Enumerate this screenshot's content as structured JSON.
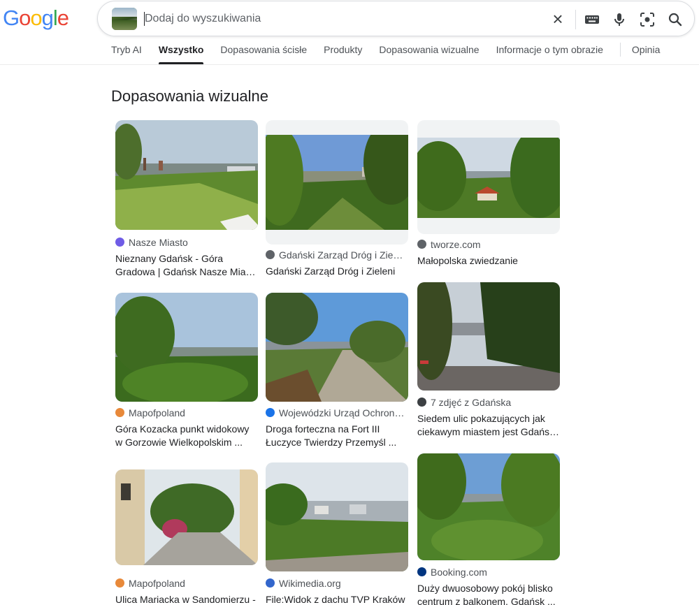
{
  "header": {
    "logo_letters": [
      "G",
      "o",
      "o",
      "g",
      "l",
      "e"
    ],
    "logo_colors": [
      "#4285F4",
      "#EA4335",
      "#FBBC05",
      "#4285F4",
      "#34A853",
      "#EA4335"
    ],
    "search": {
      "placeholder": "Dodaj do wyszukiwania",
      "value": ""
    },
    "icons": [
      "clear-icon",
      "keyboard-icon",
      "microphone-icon",
      "lens-camera-icon",
      "search-icon"
    ]
  },
  "tabs": [
    {
      "label": "Tryb AI",
      "active": false
    },
    {
      "label": "Wszystko",
      "active": true
    },
    {
      "label": "Dopasowania ścisłe",
      "active": false
    },
    {
      "label": "Produkty",
      "active": false
    },
    {
      "label": "Dopasowania wizualne",
      "active": false
    },
    {
      "label": "Informacje o tym obrazie",
      "active": false
    },
    {
      "label": "Opinia",
      "active": false
    }
  ],
  "section": {
    "title": "Dopasowania wizualne"
  },
  "results": [
    {
      "source": "Nasze Miasto",
      "favicon": "nasze-miasto-icon",
      "favicon_color": "#6f5ce6",
      "title_lines": [
        "Nieznany Gdańsk - Góra",
        "Gradowa | Gdańsk Nasze Miasto"
      ]
    },
    {
      "source": "Gdański Zarząd Dróg i Zie…",
      "favicon": "globe-icon",
      "favicon_color": "#5f6368",
      "title_lines": [
        "Gdański Zarząd Dróg i Zieleni"
      ]
    },
    {
      "source": "tworze.com",
      "favicon": "globe-icon",
      "favicon_color": "#5f6368",
      "title_lines": [
        "Małopolska zwiedzanie"
      ]
    },
    {
      "source": "Mapofpoland",
      "favicon": "mapofpoland-icon",
      "favicon_color": "#e8893a",
      "title_lines": [
        "Góra Kozacka punkt widokowy",
        "w Gorzowie Wielkopolskim ..."
      ]
    },
    {
      "source": "Wojewódzki Urząd Ochron…",
      "favicon": "wuoz-icon",
      "favicon_color": "#1a73e8",
      "title_lines": [
        "Droga forteczna na Fort III",
        "Łuczyce Twierdzy Przemyśl ..."
      ]
    },
    {
      "source": "7 zdjęć z Gdańska",
      "favicon": "seven-icon",
      "favicon_color": "#3c4043",
      "title_lines": [
        "Siedem ulic pokazujących jak",
        "ciekawym miastem jest Gdańs…"
      ]
    },
    {
      "source": "Mapofpoland",
      "favicon": "mapofpoland-icon",
      "favicon_color": "#e8893a",
      "title_lines": [
        "Ulica Mariacka w Sandomierzu -"
      ]
    },
    {
      "source": "Wikimedia.org",
      "favicon": "wikimedia-icon",
      "favicon_color": "#3366cc",
      "title_lines": [
        "File:Widok z dachu TVP Kraków"
      ]
    },
    {
      "source": "Booking.com",
      "favicon": "booking-icon",
      "favicon_color": "#003580",
      "title_lines": [
        "Duży dwuosobowy pokój blisko",
        "centrum z balkonem, Gdańsk ..."
      ]
    }
  ]
}
